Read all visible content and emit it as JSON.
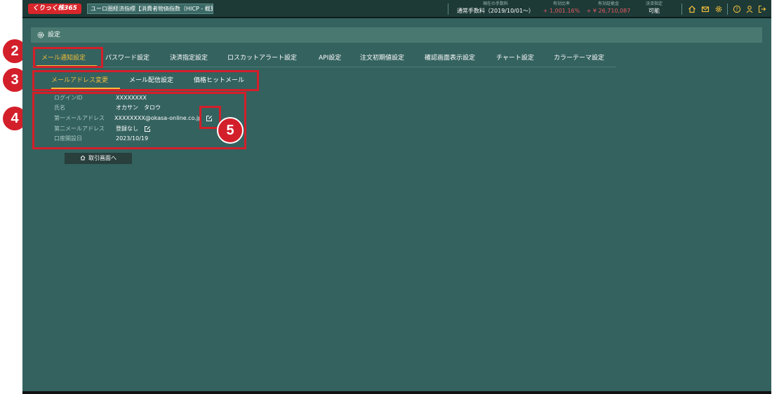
{
  "topbar": {
    "logo": "くりっく株365",
    "instrument": "ユーロ圏経済指標【消費者物価指数（HICP - 概算...",
    "stats": [
      {
        "label": "現在の手数料",
        "value": "通常手数料（2019/10/01〜）"
      },
      {
        "label": "有効比率",
        "value": "+ 1,001.16%"
      },
      {
        "label": "有効証拠金",
        "value": "+ ¥ 26,710,087"
      },
      {
        "label": "決済指定",
        "value": "可能"
      }
    ],
    "icons": [
      "home-icon",
      "mail-icon",
      "gear-icon",
      "help-icon",
      "user-icon",
      "logout-icon"
    ]
  },
  "settings": {
    "title": "設定"
  },
  "tabs": [
    {
      "label": "メール通知設定",
      "active": true
    },
    {
      "label": "パスワード設定",
      "active": false
    },
    {
      "label": "決済指定設定",
      "active": false
    },
    {
      "label": "ロスカットアラート設定",
      "active": false
    },
    {
      "label": "API設定",
      "active": false
    },
    {
      "label": "注文初期値設定",
      "active": false
    },
    {
      "label": "確認画面表示設定",
      "active": false
    },
    {
      "label": "チャート設定",
      "active": false
    },
    {
      "label": "カラーテーマ設定",
      "active": false
    }
  ],
  "subtabs": [
    {
      "label": "メールアドレス変更",
      "active": true
    },
    {
      "label": "メール配信設定",
      "active": false
    },
    {
      "label": "価格ヒットメール",
      "active": false
    }
  ],
  "account": {
    "rows": [
      {
        "key": "ログインID",
        "value": "XXXXXXXX"
      },
      {
        "key": "氏名",
        "value": "オカサン　タロウ"
      },
      {
        "key": "第一メールアドレス",
        "value": "XXXXXXXX@okasa-online.co.jp"
      },
      {
        "key": "第二メールアドレス",
        "value": "登録なし"
      },
      {
        "key": "口座開設日",
        "value": "2023/10/19"
      }
    ]
  },
  "back_button": {
    "label": "取引画面へ"
  },
  "callouts": [
    "2",
    "3",
    "4",
    "5"
  ],
  "colors": {
    "background": "#34625f",
    "accent": "#f1bd3b",
    "callout": "#d31f2a",
    "negative": "#e55b62"
  }
}
